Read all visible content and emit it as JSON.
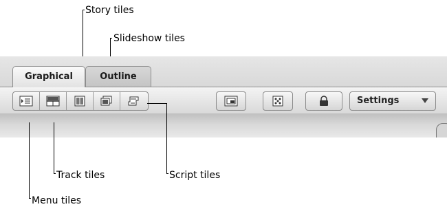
{
  "callouts": {
    "story": "Story tiles",
    "slideshow": "Slideshow tiles",
    "track": "Track tiles",
    "script": "Script tiles",
    "menu": "Menu tiles"
  },
  "tabs": [
    {
      "label": "Graphical",
      "active": true
    },
    {
      "label": "Outline",
      "active": false
    }
  ],
  "tile_buttons": [
    {
      "name": "menu-tiles",
      "icon": "menu-tile-icon"
    },
    {
      "name": "track-tiles",
      "icon": "track-tile-icon"
    },
    {
      "name": "story-tiles",
      "icon": "story-tile-icon"
    },
    {
      "name": "slideshow-tiles",
      "icon": "slideshow-tile-icon"
    },
    {
      "name": "script-tiles",
      "icon": "script-tile-icon"
    }
  ],
  "toolbar_buttons": [
    {
      "name": "title-safe-button",
      "icon": "title-safe-icon"
    },
    {
      "name": "display-button",
      "icon": "dice-icon"
    },
    {
      "name": "lock-button",
      "icon": "lock-icon"
    }
  ],
  "settings": {
    "label": "Settings"
  },
  "colors": {
    "ui_gray": "#d9d9d9",
    "border": "#8a8a8a",
    "text": "#000000"
  }
}
